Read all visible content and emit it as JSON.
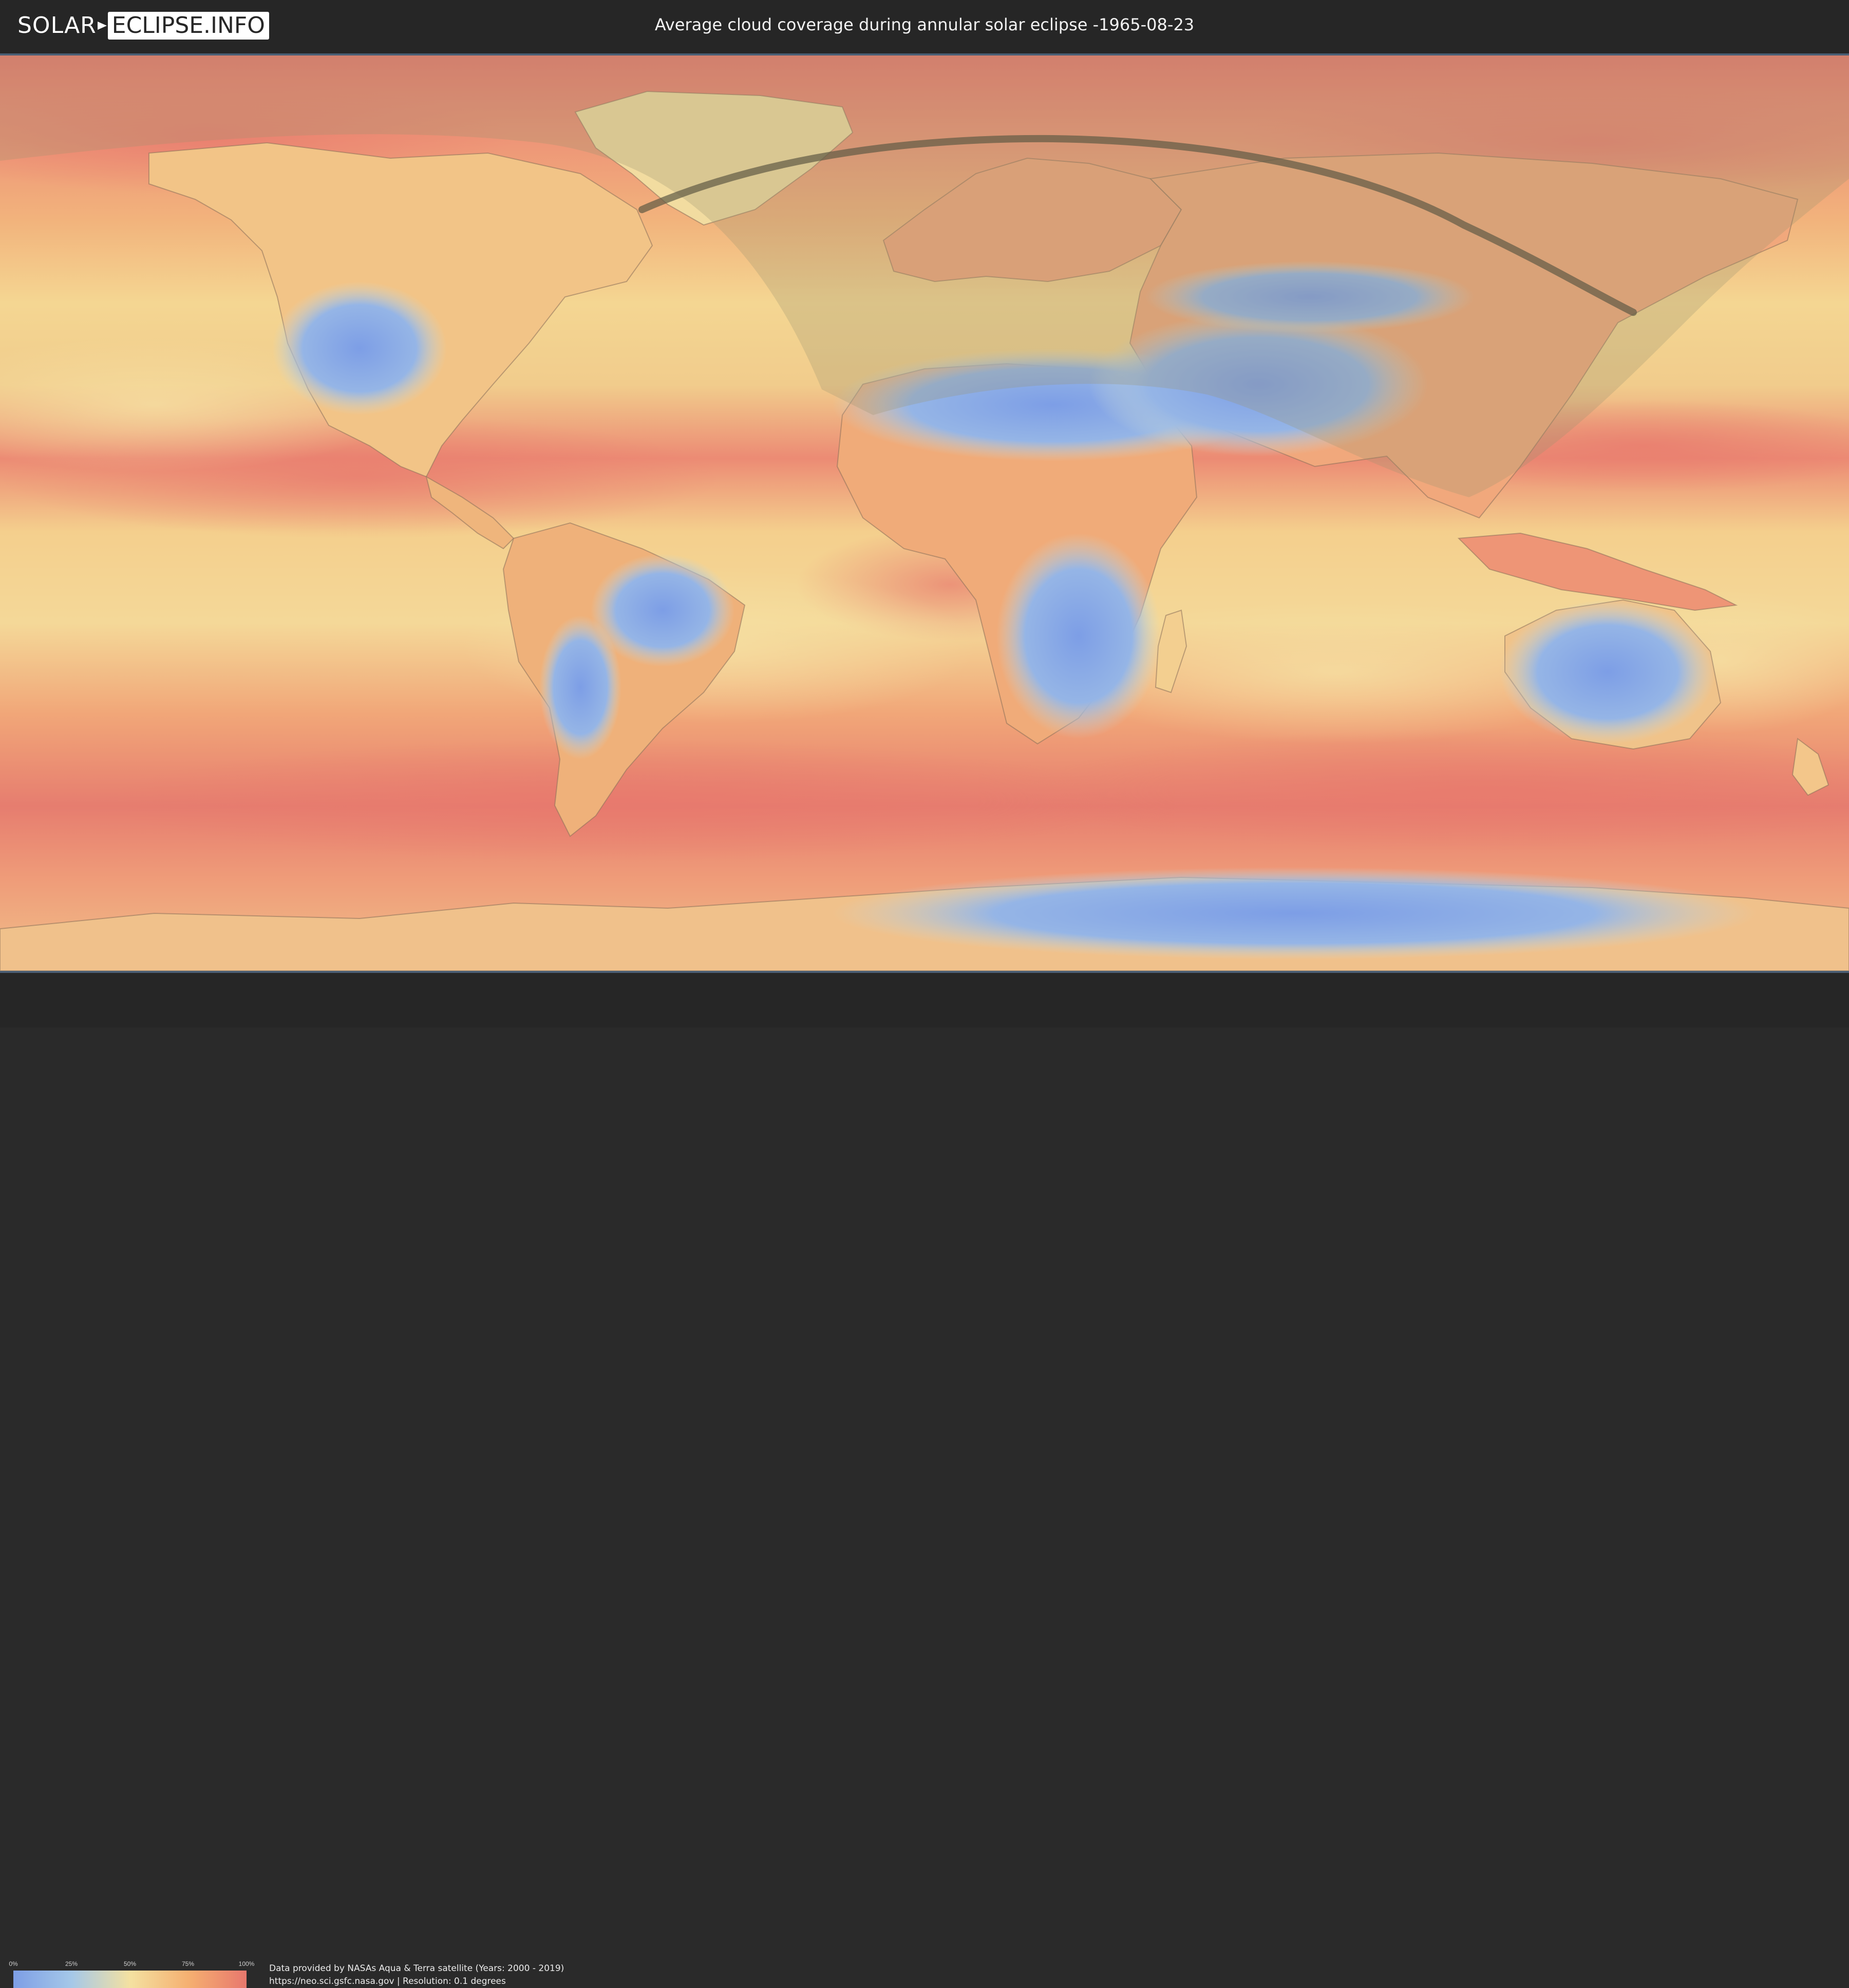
{
  "header": {
    "logo_left": "SOLAR",
    "logo_right": "ECLIPSE.INFO",
    "title": "Average cloud coverage during annular solar eclipse -1965-08-23"
  },
  "map": {
    "type": "cloud-coverage-world-map",
    "projection": "equirectangular",
    "eclipse_type": "annular",
    "date": "-1965-08-23",
    "path_color": "#5f5a45",
    "visibility_shade_color": "#9b946f",
    "colors": {
      "clear": "#7d9ee6",
      "mid": "#f4e1a1",
      "cloudy": "#e8786d",
      "land_outline": "#8a6f5a"
    }
  },
  "legend": {
    "ticks": [
      "0%",
      "25%",
      "50%",
      "75%",
      "100%"
    ],
    "gradient": [
      "#7d9ee6",
      "#a5c8e8",
      "#f4e1a1",
      "#f5b071",
      "#e8786d"
    ]
  },
  "footer": {
    "credit_line1": "Data provided by NASAs Aqua & Terra satellite (Years: 2000 - 2019)",
    "credit_line2": "https://neo.sci.gsfc.nasa.gov | Resolution: 0.1 degrees"
  }
}
